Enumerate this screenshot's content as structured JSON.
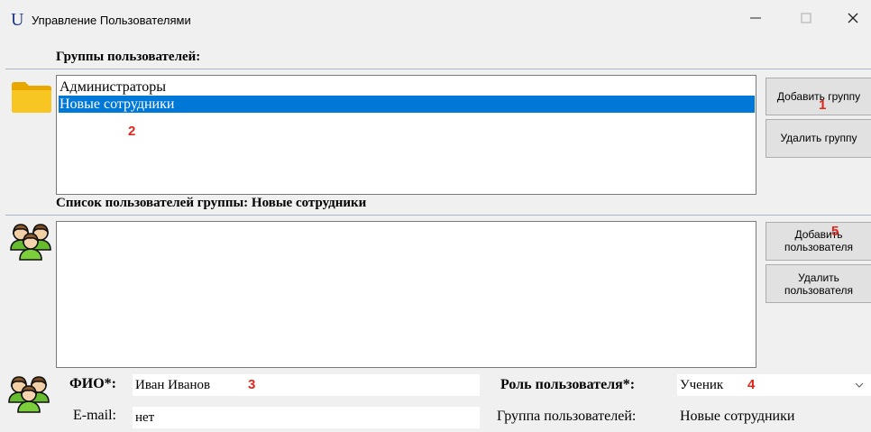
{
  "window": {
    "title": "Управление Пользователями",
    "icon_letter": "U"
  },
  "groups_section": {
    "title": "Группы пользователей:",
    "items": [
      {
        "label": "Администраторы",
        "selected": false
      },
      {
        "label": "Новые сотрудники",
        "selected": true
      }
    ],
    "add_button": "Добавить группу",
    "delete_button": "Удалить группу"
  },
  "users_section": {
    "title": "Список пользователей группы: Новые сотрудники",
    "items": [],
    "add_button_line1": "Добавить",
    "add_button_line2": "пользователя",
    "delete_button_line1": "Удалить",
    "delete_button_line2": "пользователя"
  },
  "form": {
    "fio_label": "ФИО*:",
    "fio_value": "Иван Иванов",
    "email_label": "E-mail:",
    "email_value": "нет",
    "role_label": "Роль пользователя*:",
    "role_value": "Ученик",
    "group_label": "Группа пользователей:",
    "group_value": "Новые сотрудники"
  },
  "annotations": {
    "n1": "1",
    "n2": "2",
    "n3": "3",
    "n4": "4",
    "n5": "5"
  },
  "colors": {
    "selection": "#0078d7",
    "annotation_red": "#e0261b",
    "folder": "#f5c518"
  }
}
